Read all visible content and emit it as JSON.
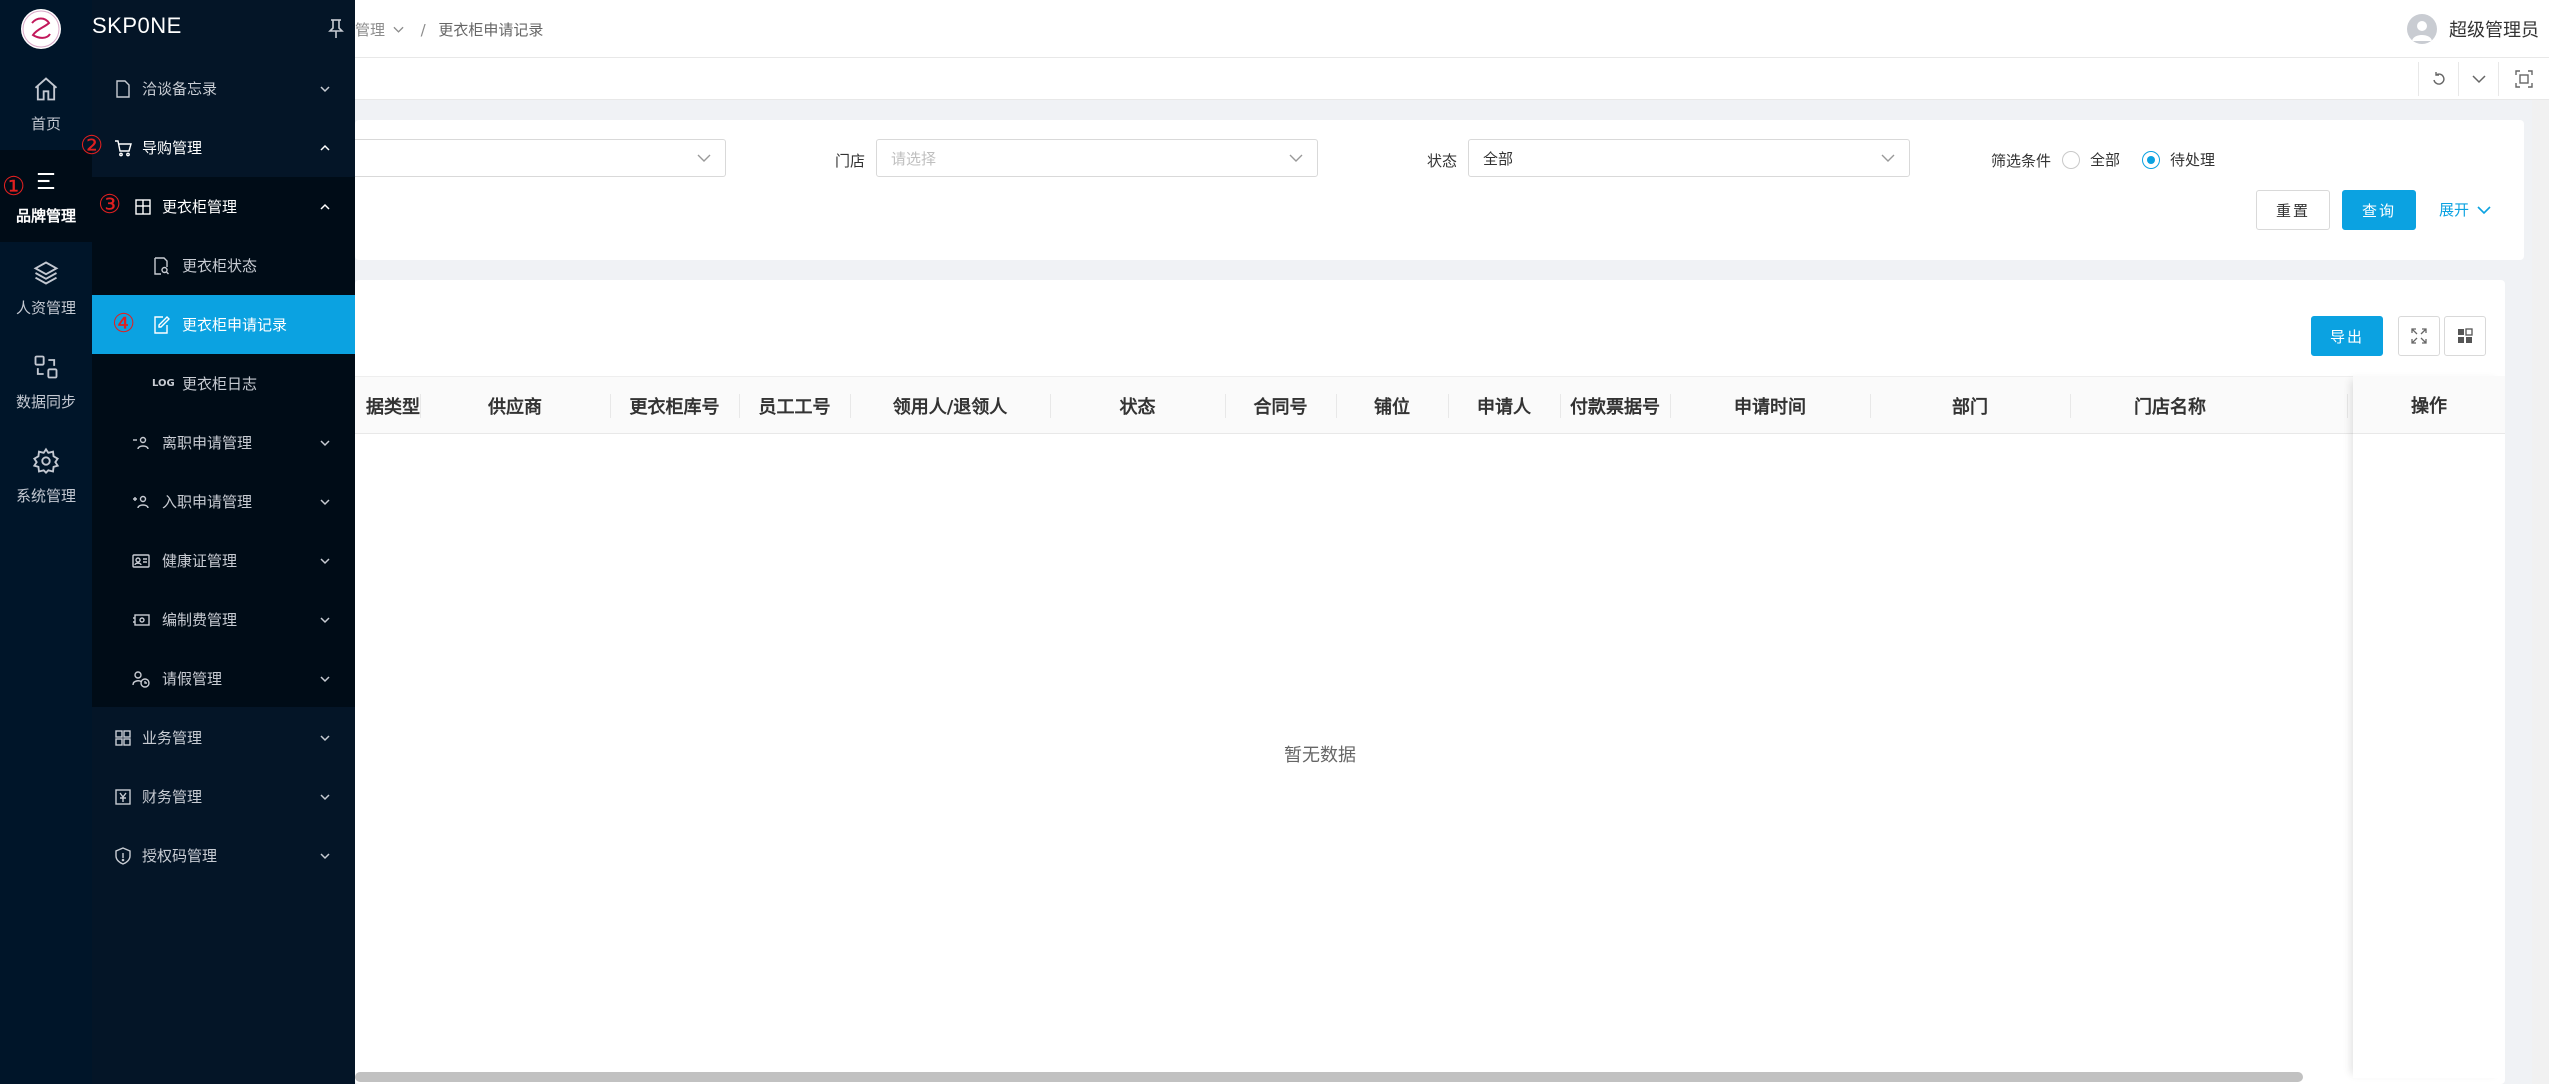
{
  "brand": {
    "name": "SKP0NE"
  },
  "rail": [
    {
      "label": "首页",
      "icon": "home-icon"
    },
    {
      "label": "品牌管理",
      "icon": "list-icon",
      "active": true
    },
    {
      "label": "人资管理",
      "icon": "layers-icon"
    },
    {
      "label": "数据同步",
      "icon": "sync-icon"
    },
    {
      "label": "系统管理",
      "icon": "gear-icon"
    }
  ],
  "annotations": {
    "n1": "①",
    "n2": "②",
    "n3": "③",
    "n4": "④"
  },
  "menu": {
    "m0": "洽谈备忘录",
    "m1": "导购管理",
    "m2": "更衣柜管理",
    "m3": "更衣柜状态",
    "m4": "更衣柜申请记录",
    "m4_log": "LOG",
    "m5": "更衣柜日志",
    "m6": "离职申请管理",
    "m7": "入职申请管理",
    "m8": "健康证管理",
    "m9": "编制费管理",
    "m10": "请假管理",
    "m11": "业务管理",
    "m12": "财务管理",
    "m13": "授权码管理"
  },
  "header": {
    "crumb_parent": "管理",
    "crumb_sep": "/",
    "crumb_current": "更衣柜申请记录",
    "user": "超级管理员"
  },
  "search": {
    "store_label": "门店",
    "store_placeholder": "请选择",
    "status_label": "状态",
    "status_value": "全部",
    "filter_label": "筛选条件",
    "filter_all": "全部",
    "filter_pending": "待处理",
    "reset": "重置",
    "query": "查询",
    "expand": "展开"
  },
  "table": {
    "export": "导出",
    "columns": [
      "据类型",
      "供应商",
      "更衣柜库号",
      "员工工号",
      "领用人/退领人",
      "状态",
      "合同号",
      "铺位",
      "申请人",
      "付款票据号",
      "申请时间",
      "部门",
      "门店名称"
    ],
    "action_col": "操作",
    "empty": "暂无数据"
  },
  "colors": {
    "accent": "#0ba2e1",
    "sidebar": "#001529",
    "annotation": "#e02020"
  }
}
